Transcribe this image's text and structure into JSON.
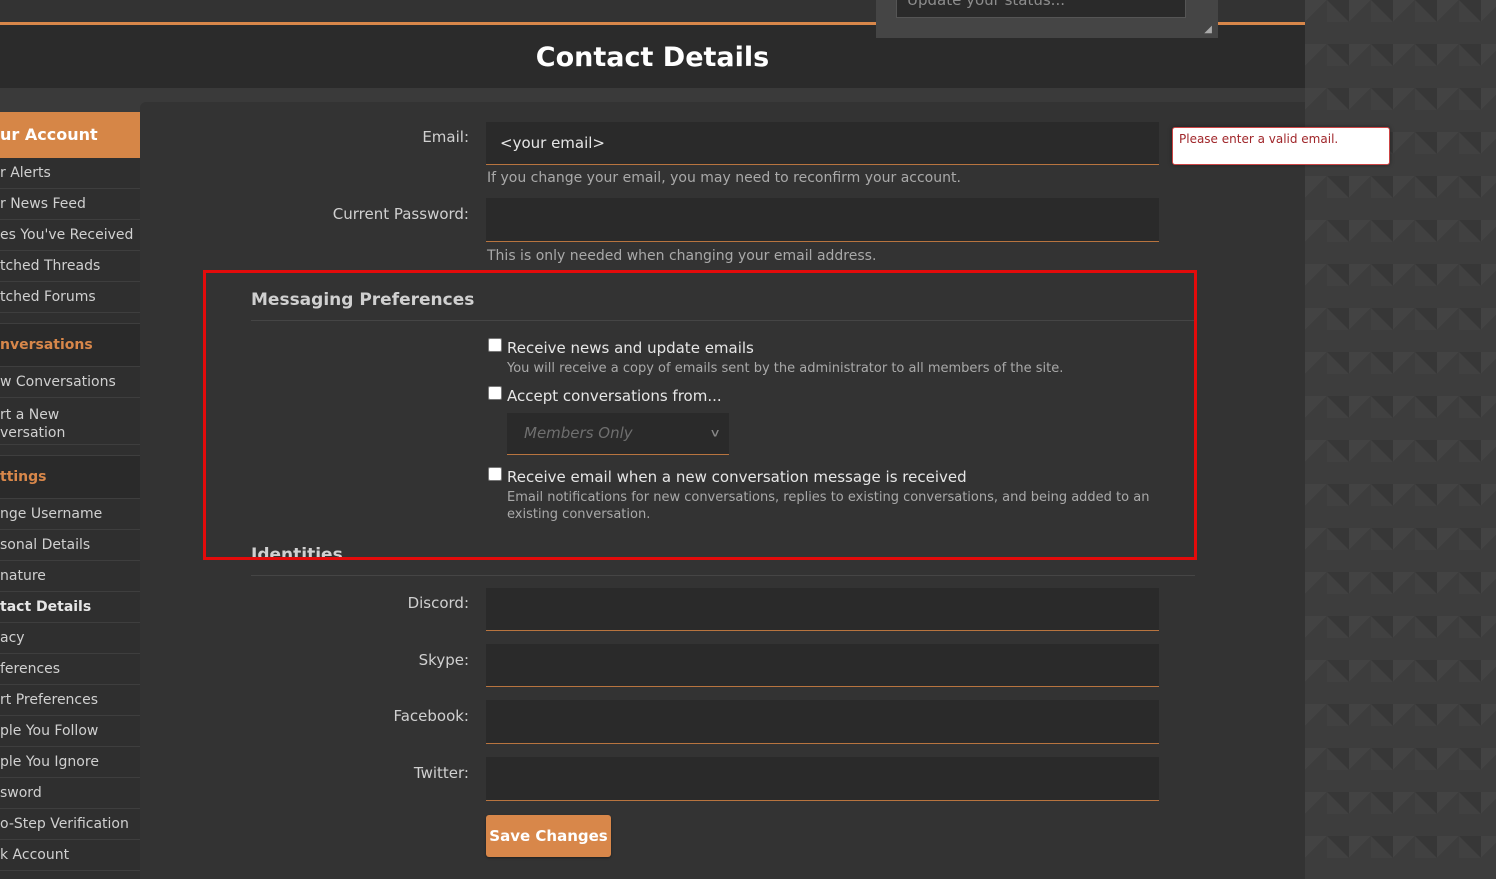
{
  "page": {
    "title": "Contact Details"
  },
  "status": {
    "placeholder": "Update your status..."
  },
  "sidebar": {
    "header": "ur Account",
    "account_items": [
      "r Alerts",
      "r News Feed",
      "es You've Received",
      "tched Threads",
      "tched Forums"
    ],
    "conversations_header": "nversations",
    "conversation_items": [
      "w Conversations",
      "rt a New\nversation"
    ],
    "settings_header": "ttings",
    "settings_items": [
      "nge Username",
      "sonal Details",
      "nature",
      "tact Details",
      "acy",
      "ferences",
      "rt Preferences",
      "ple You Follow",
      "ple You Ignore",
      "sword",
      "o-Step Verification",
      "k Account"
    ]
  },
  "form": {
    "email_label": "Email:",
    "email_value": "<your email>",
    "email_hint": "If you change your email, you may need to reconfirm your account.",
    "email_error": "Please enter a valid email.",
    "password_label": "Current Password:",
    "password_hint": "This is only needed when changing your email address.",
    "messaging_title": "Messaging Preferences",
    "opt_news_label": "Receive news and update emails",
    "opt_news_desc": "You will receive a copy of emails sent by the administrator to all members of the site.",
    "opt_conv_label": "Accept conversations from...",
    "opt_conv_select": "Members Only",
    "opt_email_label": "Receive email when a new conversation message is received",
    "opt_email_desc": "Email notifications for new conversations, replies to existing conversations, and being added to an existing conversation.",
    "identities_title": "Identities",
    "discord_label": "Discord:",
    "skype_label": "Skype:",
    "facebook_label": "Facebook:",
    "twitter_label": "Twitter:",
    "save_label": "Save Changes"
  },
  "colors": {
    "accent": "#d8874a",
    "highlight": "#e30b0b",
    "error": "#a0262a"
  }
}
